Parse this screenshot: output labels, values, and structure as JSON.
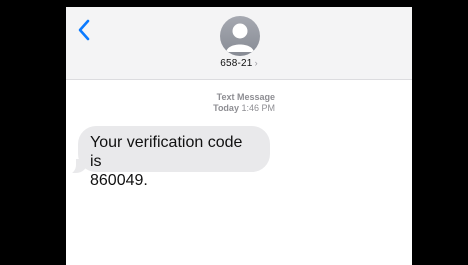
{
  "header": {
    "back_icon": "chevron-left-icon",
    "avatar_icon": "person-icon",
    "contact_name": "658-21",
    "contact_chevron": "›"
  },
  "conversation": {
    "service_label": "Text Message",
    "day_label": "Today",
    "time_label": "1:46 PM",
    "messages": [
      {
        "direction": "incoming",
        "line1": "Your verification code is",
        "line2": "860049."
      }
    ]
  },
  "colors": {
    "accent": "#0a7aff",
    "bubble_incoming": "#e9e9eb",
    "header_bg": "#f4f4f5",
    "meta_text": "#8e8e93"
  }
}
